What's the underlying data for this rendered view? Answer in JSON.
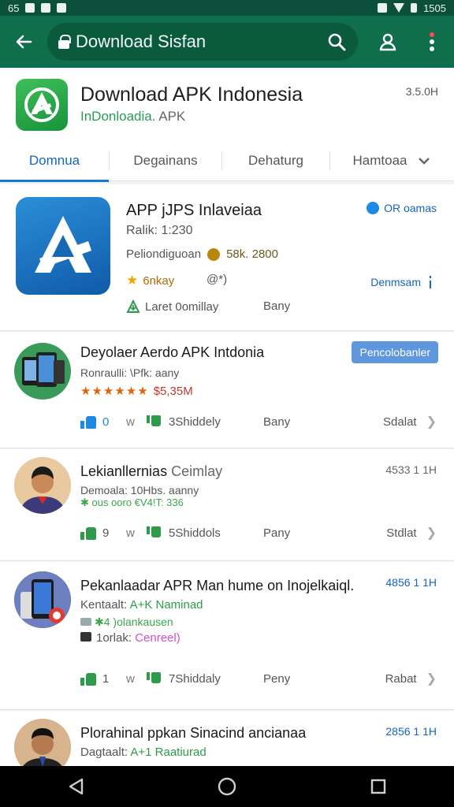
{
  "status_bar": {
    "left_text": "65",
    "time": "1505"
  },
  "app_bar": {
    "search_text": "Download Sisfan",
    "icons": [
      "back-arrow-icon",
      "lock-icon",
      "search-icon",
      "account-icon",
      "more-vert-icon"
    ],
    "color": "#0f6e4c"
  },
  "app": {
    "title": "Download APK Indonesia",
    "subtitle_green": "InDonloadia.",
    "subtitle_rest": " APK",
    "size": "3.5.0H"
  },
  "tabs": [
    {
      "label": "Domnua",
      "active": true
    },
    {
      "label": "Degainans"
    },
    {
      "label": "Dehaturg"
    },
    {
      "label": "Hamtoaa"
    }
  ],
  "featured": {
    "title": "APP jJPS Inlaveiaa",
    "rank": "Ralik: 1:230",
    "perf_label": "Peliondiguoan",
    "perf_value": "58k. 2800",
    "rating_label": "6nkay",
    "extra": "@*)",
    "install_label": "Laret 0omillay",
    "bany": "Bany",
    "verified": "OR oamas",
    "download": "Denmsam"
  },
  "list": [
    {
      "title": "Deyolaer Aerdo APK Intdonia",
      "line1": "Ronraulli: \\Pfk: aany",
      "stars": "★★★★★★",
      "price": "$5,35M",
      "badge": "Pencolobanler",
      "up_count": "0",
      "w": "w",
      "down_text": "3Shiddely",
      "bany": "Bany",
      "more": "Sdalat"
    },
    {
      "title": "Lekianllernias",
      "title_gray": " Ceimlay",
      "line1": "Demoala: 10Hbs. aanny",
      "line2": "✱ ous ooro €V4!T: 336",
      "count": "4533 1 1H",
      "up_count": "9",
      "w": "w",
      "down_text": "5Shiddols",
      "bany": "Pany",
      "more": "Stdlat"
    },
    {
      "title": "Pekanlaadar APR Man hume on Inojelkaiql.",
      "line1_label": "Kentaalt: ",
      "line1_green": "A+K Naminad",
      "line2": "✱4 )olankausen",
      "line3_label": "1orlak: ",
      "line3_pink": "Cenreel)",
      "count": "4856 1 1H",
      "up_count": "1",
      "w": "w",
      "down_text": "7Shiddaly",
      "bany": "Peny",
      "more": "Rabat"
    },
    {
      "title": "Plorahinal ppkan Sinacind ancianaa",
      "line1_label": "Dagtaalt: ",
      "line1_green": "A+1 Raatiurad",
      "count": "2856 1 1H"
    }
  ],
  "nav": [
    "back-triangle-icon",
    "home-circle-icon",
    "recents-square-icon"
  ]
}
